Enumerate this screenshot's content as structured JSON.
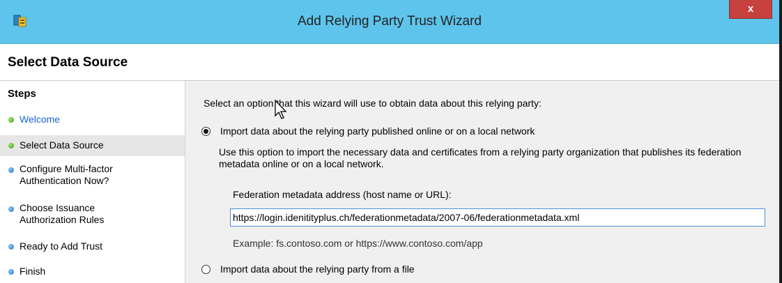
{
  "window": {
    "title": "Add Relying Party Trust Wizard",
    "close_label": "x"
  },
  "header": {
    "title": "Select Data Source"
  },
  "sidebar": {
    "title": "Steps",
    "steps": [
      {
        "label": "Welcome",
        "status": "green",
        "link": true
      },
      {
        "label": "Select Data Source",
        "status": "green",
        "current": true
      },
      {
        "label": "Configure Multi-factor\nAuthentication Now?",
        "status": "blue"
      },
      {
        "label": "Choose Issuance\nAuthorization Rules",
        "status": "blue"
      },
      {
        "label": "Ready to Add Trust",
        "status": "blue"
      },
      {
        "label": "Finish",
        "status": "blue"
      }
    ]
  },
  "main": {
    "prompt": "Select an option that this wizard will use to obtain data about this relying party:",
    "option_online": {
      "label": "Import data about the relying party published online or on a local network",
      "selected": true,
      "description": "Use this option to import the necessary data and certificates from a relying party organization that publishes its federation metadata online or on a local network."
    },
    "metadata_field": {
      "label": "Federation metadata address (host name or URL):",
      "value": "https://login.idenitityplus.ch/federationmetadata/2007-06/federationmetadata.xml",
      "example": "Example: fs.contoso.com or https://www.contoso.com/app"
    },
    "option_file": {
      "label": "Import data about the relying party from a file",
      "selected": false
    }
  },
  "colors": {
    "titlebar": "#5ec4eb",
    "close_button": "#c7423f",
    "link": "#1a64d8",
    "content_bg": "#f0f0f0"
  }
}
